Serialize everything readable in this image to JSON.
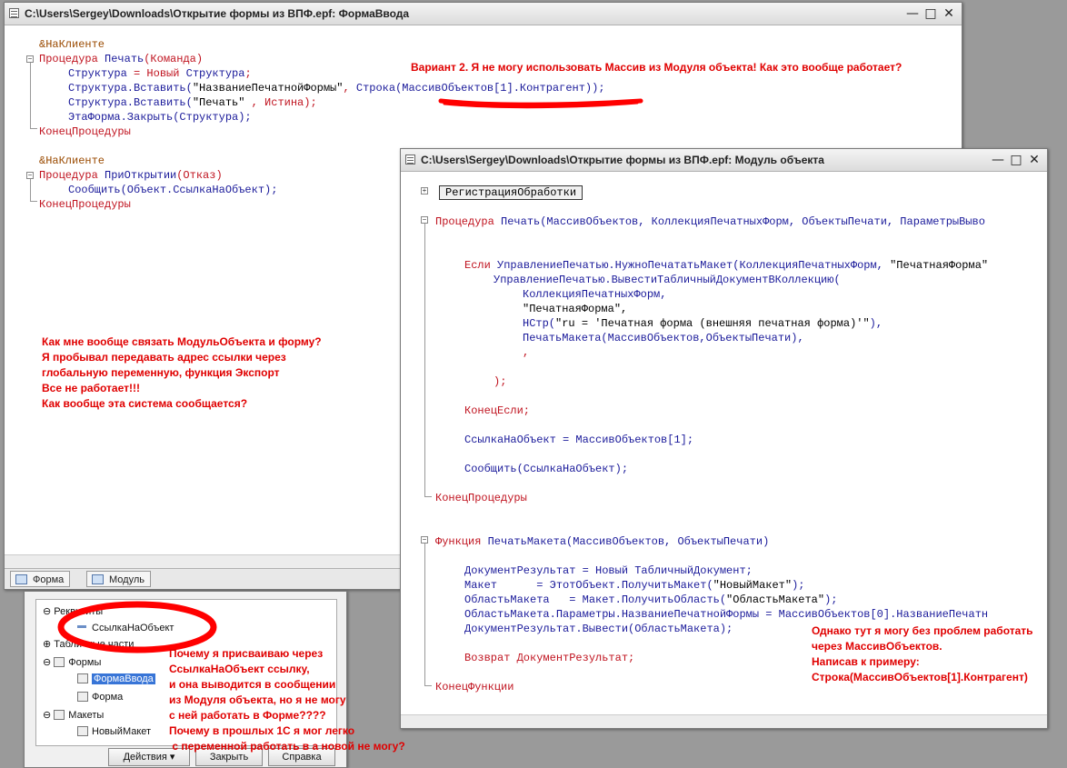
{
  "form_window": {
    "title": "C:\\Users\\Sergey\\Downloads\\Открытие формы из ВПФ.epf: ФормаВвода",
    "tabs": [
      "Форма",
      "Модуль"
    ],
    "code": {
      "l1": "&НаКлиенте",
      "l2a": "Процедура ",
      "l2b": "Печать",
      "l2c": "(Команда)",
      "l3a": "Структура",
      "l3b": " = Новый ",
      "l3c": "Структура",
      "l3d": ";",
      "l4a": "Структура.Вставить(",
      "l4b": "\"НазваниеПечатнойФормы\"",
      "l4c": ", ",
      "l4d": "Строка(МассивОбъектов[1].Контрагент));",
      "l5a": "Структура.Вставить(",
      "l5b": "\"Печать\"",
      "l5c": " , Истина);",
      "l6": "ЭтаФорма.Закрыть(Структура);",
      "l7": "КонецПроцедуры",
      "l8": "&НаКлиенте",
      "l9a": "Процедура ",
      "l9b": "ПриОткрытии",
      "l9c": "(Отказ)",
      "l10": "Сообщить(Объект.СсылкаНаОбъект);",
      "l11": "КонецПроцедуры"
    }
  },
  "module_window": {
    "title": "C:\\Users\\Sergey\\Downloads\\Открытие формы из ВПФ.epf: Модуль объекта",
    "code": {
      "reg": "РегистрацияОбработки",
      "p1a": "Процедура ",
      "p1b": "Печать",
      "p1c": "(МассивОбъектов, КоллекцияПечатныхФорм, ОбъектыПечати, ПараметрыВыво",
      "p2a": "Если ",
      "p2b": "УправлениеПечатью.НужноПечататьМакет(КоллекцияПечатныхФорм, ",
      "p2c": "\"ПечатнаяФорма\"",
      "p3": "УправлениеПечатью.ВывестиТабличныйДокументВКоллекцию(",
      "p4": "КоллекцияПечатныхФорм,",
      "p5": "\"ПечатнаяФорма\",",
      "p6a": "НСтр(",
      "p6b": "\"ru = 'Печатная форма (внешняя печатная форма)'\"",
      "p6c": "),",
      "p7": "ПечатьМакета(МассивОбъектов,ОбъектыПечати),",
      "p8": ",",
      "p9": ");",
      "p10": "КонецЕсли;",
      "p11": "СсылкаНаОбъект = МассивОбъектов[1];",
      "p12": "Сообщить(СсылкаНаОбъект);",
      "p13": "КонецПроцедуры",
      "f1a": "Функция ",
      "f1b": "ПечатьМакета",
      "f1c": "(МассивОбъектов, ОбъектыПечати)",
      "f2": "ДокументРезультат = Новый ТабличныйДокумент;",
      "f3a": "Макет      = ЭтотОбъект.ПолучитьМакет(",
      "f3b": "\"НовыйМакет\"",
      "f3c": ");",
      "f4a": "ОбластьМакета   = Макет.ПолучитьОбласть(",
      "f4b": "\"ОбластьМакета\"",
      "f4c": ");",
      "f5": "ОбластьМакета.Параметры.НазваниеПечатнойФормы = МассивОбъектов[0].НазваниеПечатн",
      "f6": "ДокументРезультат.Вывести(ОбластьМакета);",
      "f7": "Возврат ДокументРезультат;",
      "f8": "КонецФункции"
    }
  },
  "tree": {
    "rekv": "Реквизиты",
    "ssylka": "СсылкаНаОбъект",
    "tabl": "Табличные части",
    "formy": "Формы",
    "formavvoda": "ФормаВвода",
    "forma": "Форма",
    "makety": "Макеты",
    "novmaket": "НовыйМакет"
  },
  "buttons": {
    "actions": "Действия",
    "close": "Закрыть",
    "help": "Справка"
  },
  "notes": {
    "n1": "Вариант 2. Я не могу использовать Массив из Модуля объекта! Как это вообще работает?",
    "n2": "Как мне вообще связать МодульОбъекта и форму?\nЯ пробывал передавать адрес ссылки через\nглобальную переменную, функция Экспорт\nВсе не работает!!!\nКак вообще эта система сообщается?",
    "n3": "Почему я присваиваю через\nСсылкаНаОбъект ссылку,\nи она выводится в сообщении\nиз Модуля объекта, но я не могу\nс ней работать в Форме????\nПочему в прошлых 1С я мог легко\n с переменной работать в а новой не могу?",
    "n4": "Однако тут я могу без проблем работать\nчерез МассивОбъектов.\nНаписав к примеру:\nСтрока(МассивОбъектов[1].Контрагент)"
  },
  "colors": {
    "annotation": "#e00000",
    "keyword": "#c0131f",
    "identifier": "#1a1a9a"
  }
}
